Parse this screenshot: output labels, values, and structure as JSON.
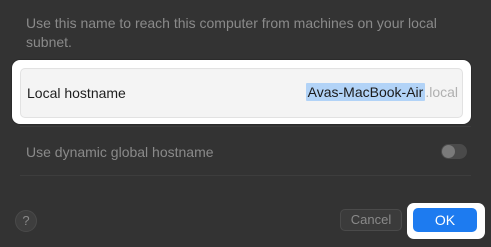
{
  "description": "Use this name to reach this computer from machines on your local subnet.",
  "local_hostname": {
    "label": "Local hostname",
    "value": "Avas-MacBook-Air",
    "suffix": ".local"
  },
  "dynamic_hostname": {
    "label": "Use dynamic global hostname",
    "enabled": false
  },
  "buttons": {
    "help": "?",
    "cancel": "Cancel",
    "ok": "OK"
  },
  "colors": {
    "accent": "#1d7bf0",
    "selection": "#b2d3f7"
  }
}
